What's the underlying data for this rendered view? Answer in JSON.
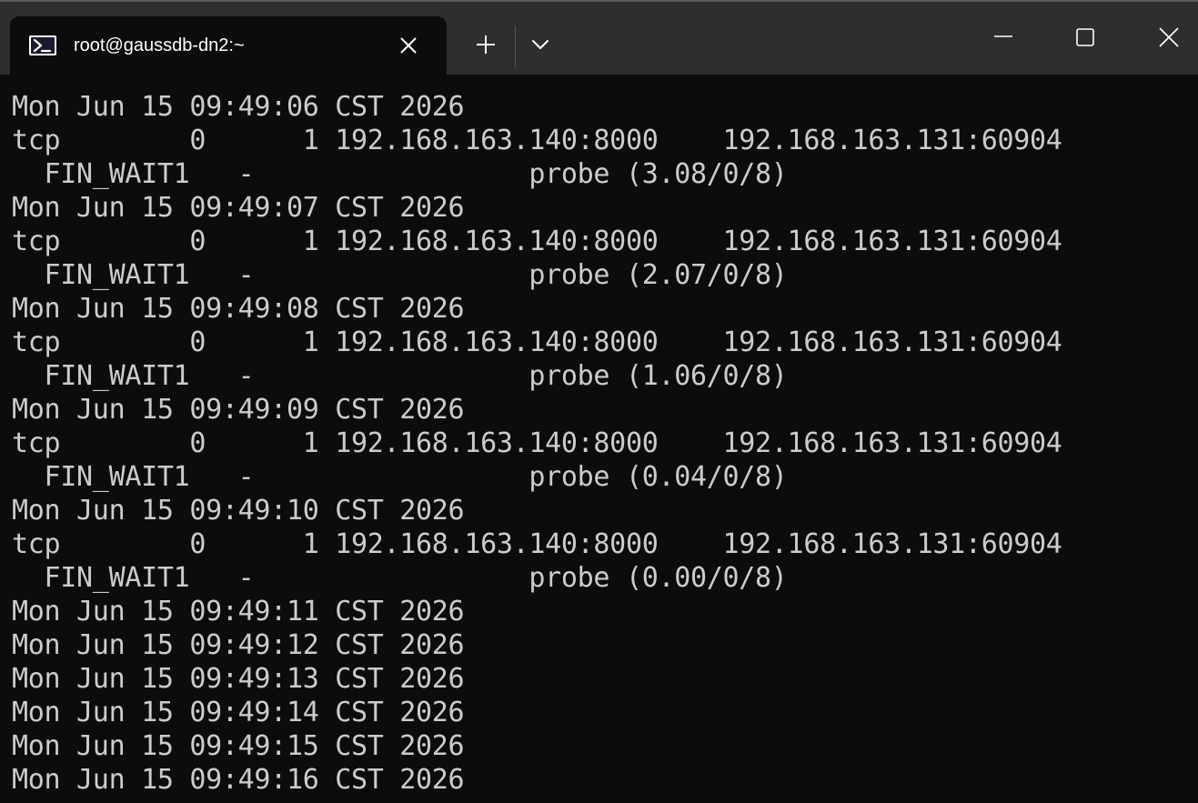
{
  "tab": {
    "title": "root@gaussdb-dn2:~",
    "icon": "powershell-icon",
    "close_icon": "close-icon"
  },
  "titlebar": {
    "new_tab_icon": "plus-icon",
    "dropdown_icon": "chevron-down-icon",
    "minimize_icon": "minimize-icon",
    "maximize_icon": "maximize-icon",
    "close_icon": "close-icon"
  },
  "colors": {
    "terminal_bg": "#0c0c0c",
    "terminal_fg": "#cccccc",
    "titlebar_bg": "#2e2e2e"
  },
  "terminal": {
    "lines": [
      "Mon Jun 15 09:49:06 CST 2026",
      "tcp        0      1 192.168.163.140:8000    192.168.163.131:60904",
      "  FIN_WAIT1   -                 probe (3.08/0/8)",
      "Mon Jun 15 09:49:07 CST 2026",
      "tcp        0      1 192.168.163.140:8000    192.168.163.131:60904",
      "  FIN_WAIT1   -                 probe (2.07/0/8)",
      "Mon Jun 15 09:49:08 CST 2026",
      "tcp        0      1 192.168.163.140:8000    192.168.163.131:60904",
      "  FIN_WAIT1   -                 probe (1.06/0/8)",
      "Mon Jun 15 09:49:09 CST 2026",
      "tcp        0      1 192.168.163.140:8000    192.168.163.131:60904",
      "  FIN_WAIT1   -                 probe (0.04/0/8)",
      "Mon Jun 15 09:49:10 CST 2026",
      "tcp        0      1 192.168.163.140:8000    192.168.163.131:60904",
      "  FIN_WAIT1   -                 probe (0.00/0/8)",
      "Mon Jun 15 09:49:11 CST 2026",
      "Mon Jun 15 09:49:12 CST 2026",
      "Mon Jun 15 09:49:13 CST 2026",
      "Mon Jun 15 09:49:14 CST 2026",
      "Mon Jun 15 09:49:15 CST 2026",
      "Mon Jun 15 09:49:16 CST 2026"
    ]
  }
}
